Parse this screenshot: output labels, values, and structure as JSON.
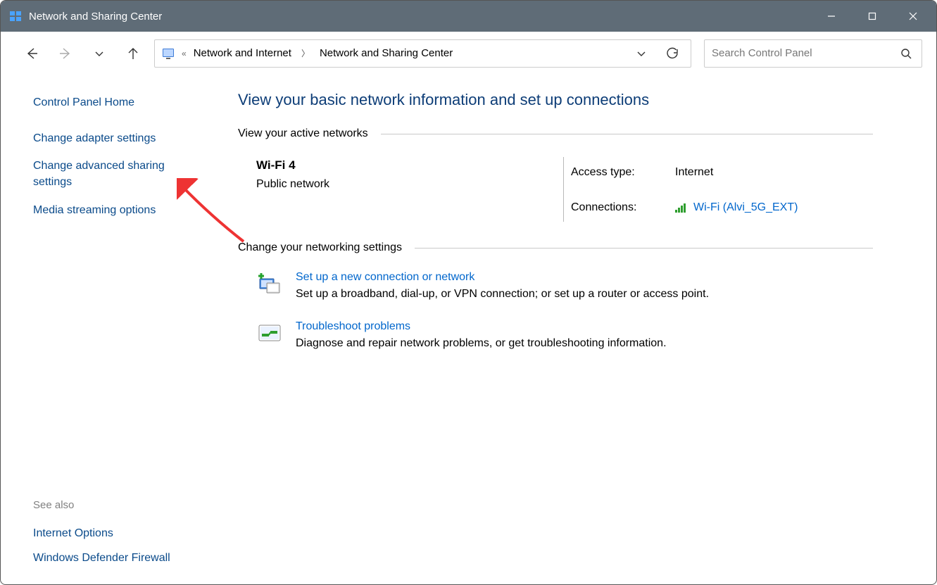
{
  "window": {
    "title": "Network and Sharing Center"
  },
  "breadcrumb": {
    "seg1": "Network and Internet",
    "seg2": "Network and Sharing Center"
  },
  "search": {
    "placeholder": "Search Control Panel"
  },
  "sidebar": {
    "home": "Control Panel Home",
    "links": [
      "Change adapter settings",
      "Change advanced sharing settings",
      "Media streaming options"
    ],
    "see_also_header": "See also",
    "see_also": [
      "Internet Options",
      "Windows Defender Firewall"
    ]
  },
  "main": {
    "title": "View your basic network information and set up connections",
    "active_header": "View your active networks",
    "network": {
      "name": "Wi-Fi 4",
      "type": "Public network",
      "access_label": "Access type:",
      "access_value": "Internet",
      "conn_label": "Connections:",
      "conn_value": "Wi-Fi (Alvi_5G_EXT)"
    },
    "change_header": "Change your networking settings",
    "settings": [
      {
        "link": "Set up a new connection or network",
        "desc": "Set up a broadband, dial-up, or VPN connection; or set up a router or access point."
      },
      {
        "link": "Troubleshoot problems",
        "desc": "Diagnose and repair network problems, or get troubleshooting information."
      }
    ]
  }
}
